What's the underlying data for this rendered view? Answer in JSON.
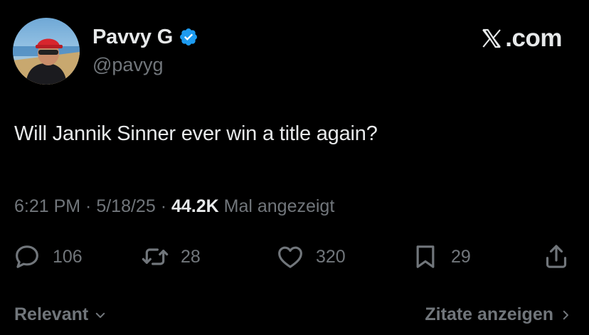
{
  "author": {
    "display_name": "Pavvy G",
    "handle": "@pavyg",
    "verified_icon": "verified-badge-icon"
  },
  "brand": {
    "icon": "x-logo-icon",
    "suffix": ".com"
  },
  "tweet": {
    "text": "Will Jannik Sinner ever win a title again?",
    "time": "6:21 PM",
    "sep1": " · ",
    "date": "5/18/25",
    "sep2": " · ",
    "views": "44.2K",
    "views_label": " Mal angezeigt"
  },
  "actions": {
    "reply_count": "106",
    "retweet_count": "28",
    "like_count": "320",
    "bookmark_count": "29"
  },
  "footer": {
    "left_label": "Relevant",
    "right_label": "Zitate anzeigen"
  },
  "colors": {
    "background": "#000000",
    "primary_text": "#e7e9ea",
    "secondary_text": "#71767b",
    "verified_blue": "#1d9bf0"
  }
}
